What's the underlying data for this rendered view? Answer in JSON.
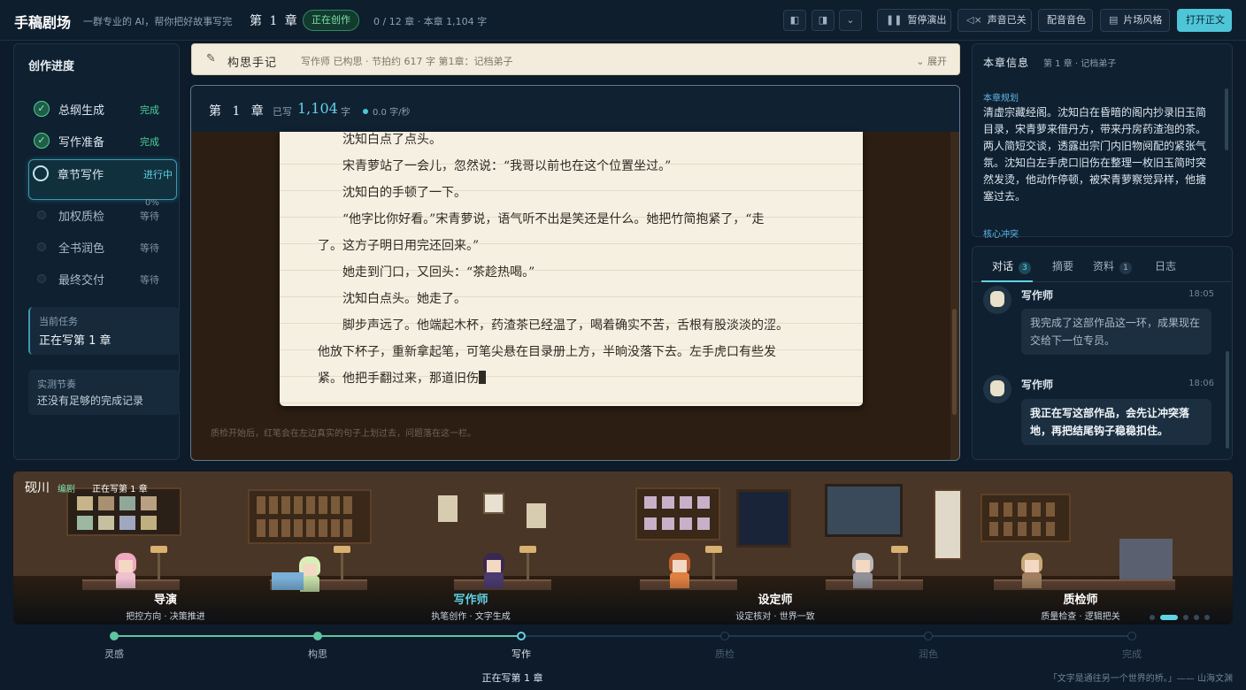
{
  "app": {
    "title": "手稿剧场",
    "slogan": "一群专业的 AI，帮你把好故事写完",
    "chapter_title": "第 1 章",
    "status": "正在创作",
    "progress": "0 / 12 章 · 本章 1,104 字"
  },
  "toolbar": {
    "pause": "暂停演出",
    "sound": "声音已关",
    "voice": "配音音色",
    "scene": "片场风格",
    "open": "打开正文"
  },
  "progress_panel": {
    "title": "创作进度",
    "steps": [
      {
        "label": "总纲生成",
        "status": "完成"
      },
      {
        "label": "写作准备",
        "status": "完成"
      },
      {
        "label": "章节写作",
        "status": "进行中",
        "percent": "0%"
      },
      {
        "label": "加权质检",
        "status": "等待"
      },
      {
        "label": "全书润色",
        "status": "等待"
      },
      {
        "label": "最终交付",
        "status": "等待"
      }
    ],
    "current_task_label": "当前任务",
    "current_task": "正在写第 1 章",
    "rhythm_label": "实测节奏",
    "rhythm": "还没有足够的完成记录"
  },
  "notes": {
    "title": "构思手记",
    "meta": "写作师   已构思 · 节拍约 617 字   第1章：记档弟子",
    "expand": "展开"
  },
  "editor": {
    "chapter": "第 1 章",
    "written_label": "已写",
    "word_count": "1,104",
    "word_unit": "字",
    "speed": "0.0 字/秒",
    "lines": [
      "　　沈知白点了点头。",
      "　　宋青萝站了一会儿，忽然说：“我哥以前也在这个位置坐过。”",
      "　　沈知白的手顿了一下。",
      "　　“他字比你好看。”宋青萝说，语气听不出是笑还是什么。她把竹简抱紧了，“走",
      "了。这方子明日用完还回来。”",
      "　　她走到门口，又回头：“茶趁热喝。”",
      "　　沈知白点头。她走了。",
      "　　脚步声远了。他端起木杯，药渣茶已经温了，喝着确实不苦，舌根有股淡淡的涩。",
      "他放下杯子，重新拿起笔，可笔尖悬在目录册上方，半晌没落下去。左手虎口有些发",
      "紧。他把手翻过来，那道旧伤"
    ],
    "footer": "质检开始后，红笔会在左边真实的句子上划过去，问题落在这一栏。"
  },
  "chapter_info": {
    "title": "本章信息",
    "subtitle": "第 1 章 · 记档弟子",
    "plan_label": "本章规划",
    "plan": "清虚宗藏经阁。沈知白在昏暗的阁内抄录旧玉简目录，宋青萝来借丹方，带来丹房药渣泡的茶。两人简短交谈，透露出宗门内旧物阋配的紧张气氛。沈知白左手虎口旧伤在整理一枚旧玉简时突然发烫，他动作停顿，被宋青萝察觉异样，他搪塞过去。",
    "conflict_label": "核心冲突"
  },
  "chat": {
    "tabs": [
      {
        "label": "对话",
        "badge": "3"
      },
      {
        "label": "摘要",
        "badge": ""
      },
      {
        "label": "资料",
        "badge": "1"
      },
      {
        "label": "日志",
        "badge": ""
      }
    ],
    "messages": [
      {
        "name": "写作师",
        "time": "18:05",
        "text": "我完成了这部作品这一环，成果现在交给下一位专员。"
      },
      {
        "name": "写作师",
        "time": "18:06",
        "text": "我正在写这部作品，会先让冲突落地，再把结尾钩子稳稳扣住。"
      }
    ]
  },
  "stage": {
    "name": "砚川",
    "tag": "编剧",
    "status": "正在写第 1 章",
    "roles": [
      {
        "name": "导演",
        "desc": "把控方向 · 决策推进"
      },
      {
        "name": "写作师",
        "desc": "执笔创作 · 文字生成"
      },
      {
        "name": "设定师",
        "desc": "设定核对 · 世界一致"
      },
      {
        "name": "质检师",
        "desc": "质量检查 · 逻辑把关"
      }
    ]
  },
  "pipeline": {
    "stages": [
      "灵感",
      "构思",
      "写作",
      "质检",
      "润色",
      "完成"
    ],
    "current": 2,
    "status": "正在写第 1 章"
  },
  "footer_quote": "「文字是通往另一个世界的桥。」—— 山海文渊",
  "colors": {
    "accent": "#5fd3e6",
    "done": "#4ad39a",
    "paper": "#f6f0e2",
    "bg": "#0d1b2a"
  }
}
